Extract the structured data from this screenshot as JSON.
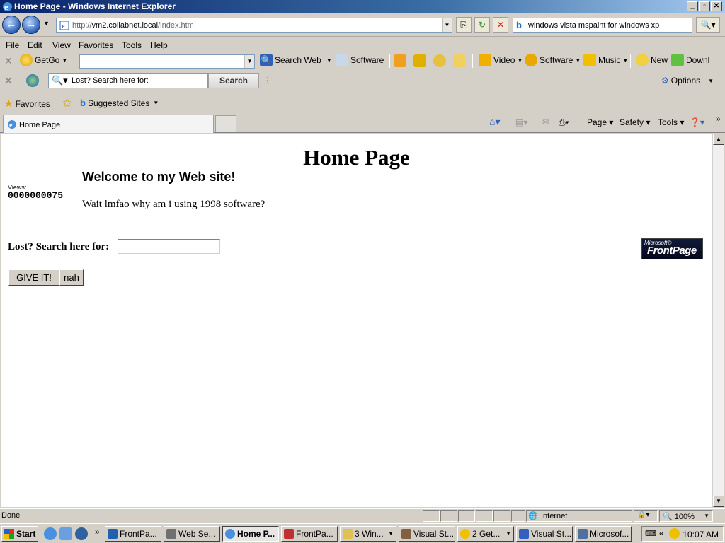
{
  "window": {
    "title": "Home Page - Windows Internet Explorer"
  },
  "address_bar": {
    "url_prefix": "http://",
    "url_host": "vm2.collabnet.local",
    "url_path": "/index.htm",
    "search_value": "windows vista mspaint for windows xp"
  },
  "menubar": {
    "items": [
      "File",
      "Edit",
      "View",
      "Favorites",
      "Tools",
      "Help"
    ]
  },
  "toolbar1": {
    "getgo": "GetGo",
    "search_web": "Search Web",
    "software": "Software",
    "video": "Video",
    "software2": "Software",
    "music": "Music",
    "new": "New",
    "download": "Downl"
  },
  "toolbar2": {
    "search_placeholder": "Lost? Search here for:",
    "search_button": "Search",
    "options": "Options"
  },
  "favorites_bar": {
    "favorites": "Favorites",
    "suggested_sites": "Suggested Sites"
  },
  "tabs": {
    "active_tab": "Home Page"
  },
  "command_bar": {
    "page": "Page",
    "safety": "Safety",
    "tools": "Tools"
  },
  "page": {
    "heading": "Home Page",
    "views_label": "Views:",
    "views_count": "0000000075",
    "welcome": "Welcome to my Web site!",
    "body_text": "Wait lmfao why am i using 1998 software?",
    "search_label": "Lost? Search here for:",
    "submit_button": "GIVE IT!",
    "reset_button": "nah",
    "logo_small": "Microsoft®",
    "logo_large": "FrontPage"
  },
  "statusbar": {
    "status": "Done",
    "zone": "Internet",
    "zoom": "100%"
  },
  "taskbar": {
    "start": "Start",
    "tasks": [
      "FrontPa...",
      "Web Se...",
      "Home P...",
      "FrontPa...",
      "3 Win...",
      "Visual St...",
      "2 Get...",
      "Visual St...",
      "Microsof..."
    ],
    "clock": "10:07 AM"
  },
  "colors": {
    "title_bar": "#0a246a",
    "ie_blue": "#2d62b8",
    "chrome": "#d4d0c8"
  }
}
